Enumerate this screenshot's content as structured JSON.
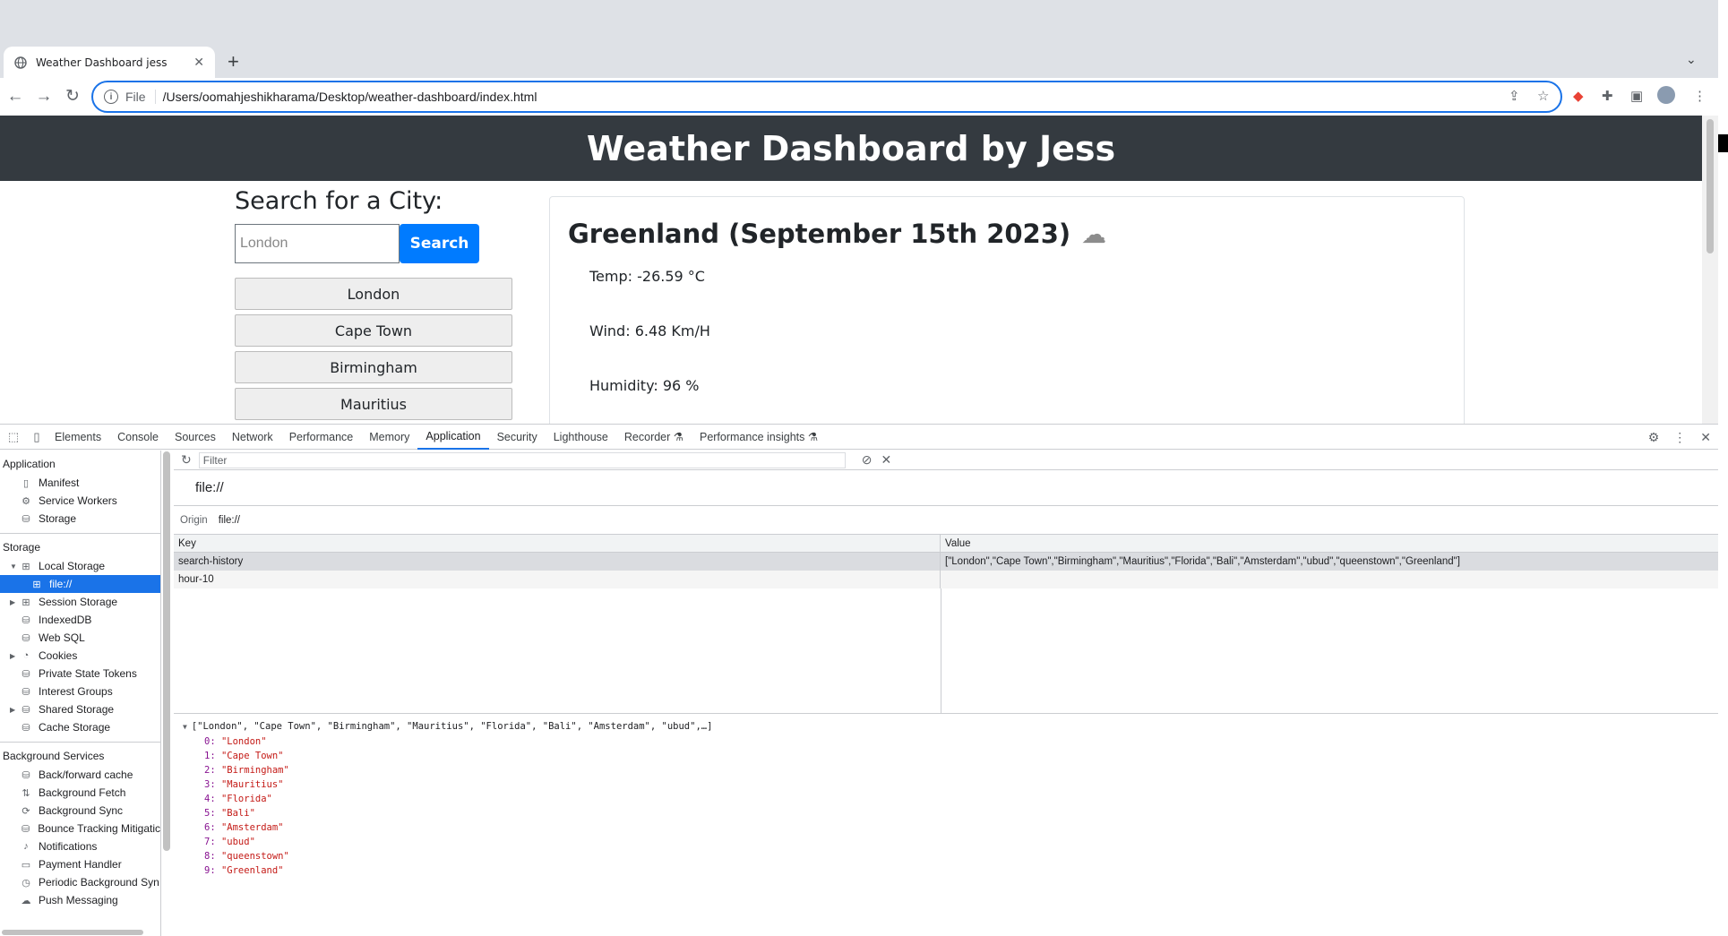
{
  "browser": {
    "tab_title": "Weather Dashboard jess",
    "tab_close": "✕",
    "new_tab": "+",
    "scheme_label": "File",
    "url": "/Users/oomahjeshikharama/Desktop/weather-dashboard/index.html"
  },
  "page": {
    "header": "Weather Dashboard by Jess",
    "search_title": "Search for a City:",
    "search_placeholder": "London",
    "search_button": "Search",
    "history": [
      "London",
      "Cape Town",
      "Birmingham",
      "Mauritius"
    ],
    "weather_title": "Greenland (September 15th 2023)",
    "weather_icon": "cloud-icon",
    "temp": "Temp: -26.59 °C",
    "wind": "Wind: 6.48 Km/H",
    "humidity": "Humidity: 96 %"
  },
  "devtools": {
    "tabs": [
      "Elements",
      "Console",
      "Sources",
      "Network",
      "Performance",
      "Memory",
      "Application",
      "Security",
      "Lighthouse",
      "Recorder ⚗",
      "Performance insights ⚗"
    ],
    "active_tab": "Application",
    "sidebar": {
      "application_title": "Application",
      "application_items": [
        "Manifest",
        "Service Workers",
        "Storage"
      ],
      "storage_title": "Storage",
      "local_storage": "Local Storage",
      "local_storage_child": "file://",
      "storage_items": [
        "Session Storage",
        "IndexedDB",
        "Web SQL",
        "Cookies",
        "Private State Tokens",
        "Interest Groups",
        "Shared Storage",
        "Cache Storage"
      ],
      "background_title": "Background Services",
      "background_items": [
        "Back/forward cache",
        "Background Fetch",
        "Background Sync",
        "Bounce Tracking Mitigatic",
        "Notifications",
        "Payment Handler",
        "Periodic Background Syn",
        "Push Messaging"
      ]
    },
    "filter_placeholder": "Filter",
    "origin_heading": "file://",
    "origin_label": "Origin",
    "origin_value": "file://",
    "table": {
      "col_key": "Key",
      "col_value": "Value",
      "rows": [
        {
          "key": "search-history",
          "value": "[\"London\",\"Cape Town\",\"Birmingham\",\"Mauritius\",\"Florida\",\"Bali\",\"Amsterdam\",\"ubud\",\"queenstown\",\"Greenland\"]"
        },
        {
          "key": "hour-10",
          "value": ""
        }
      ]
    },
    "preview_summary": "[\"London\", \"Cape Town\", \"Birmingham\", \"Mauritius\", \"Florida\", \"Bali\", \"Amsterdam\", \"ubud\",…]",
    "preview_items": [
      "\"London\"",
      "\"Cape Town\"",
      "\"Birmingham\"",
      "\"Mauritius\"",
      "\"Florida\"",
      "\"Bali\"",
      "\"Amsterdam\"",
      "\"ubud\"",
      "\"queenstown\"",
      "\"Greenland\""
    ]
  }
}
